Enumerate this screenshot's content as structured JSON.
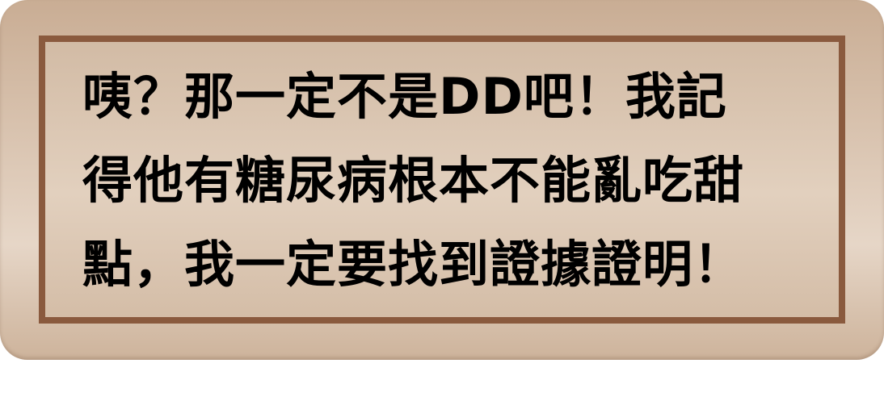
{
  "dialog": {
    "lines": [
      "咦？那一定不是DD吧！我記",
      "得他有糖尿病根本不能亂吃甜",
      "點，我一定要找到證據證明！"
    ]
  },
  "colors": {
    "panel": "#d8c2ae",
    "frame_border": "#8a5a3e",
    "text": "#000000"
  }
}
